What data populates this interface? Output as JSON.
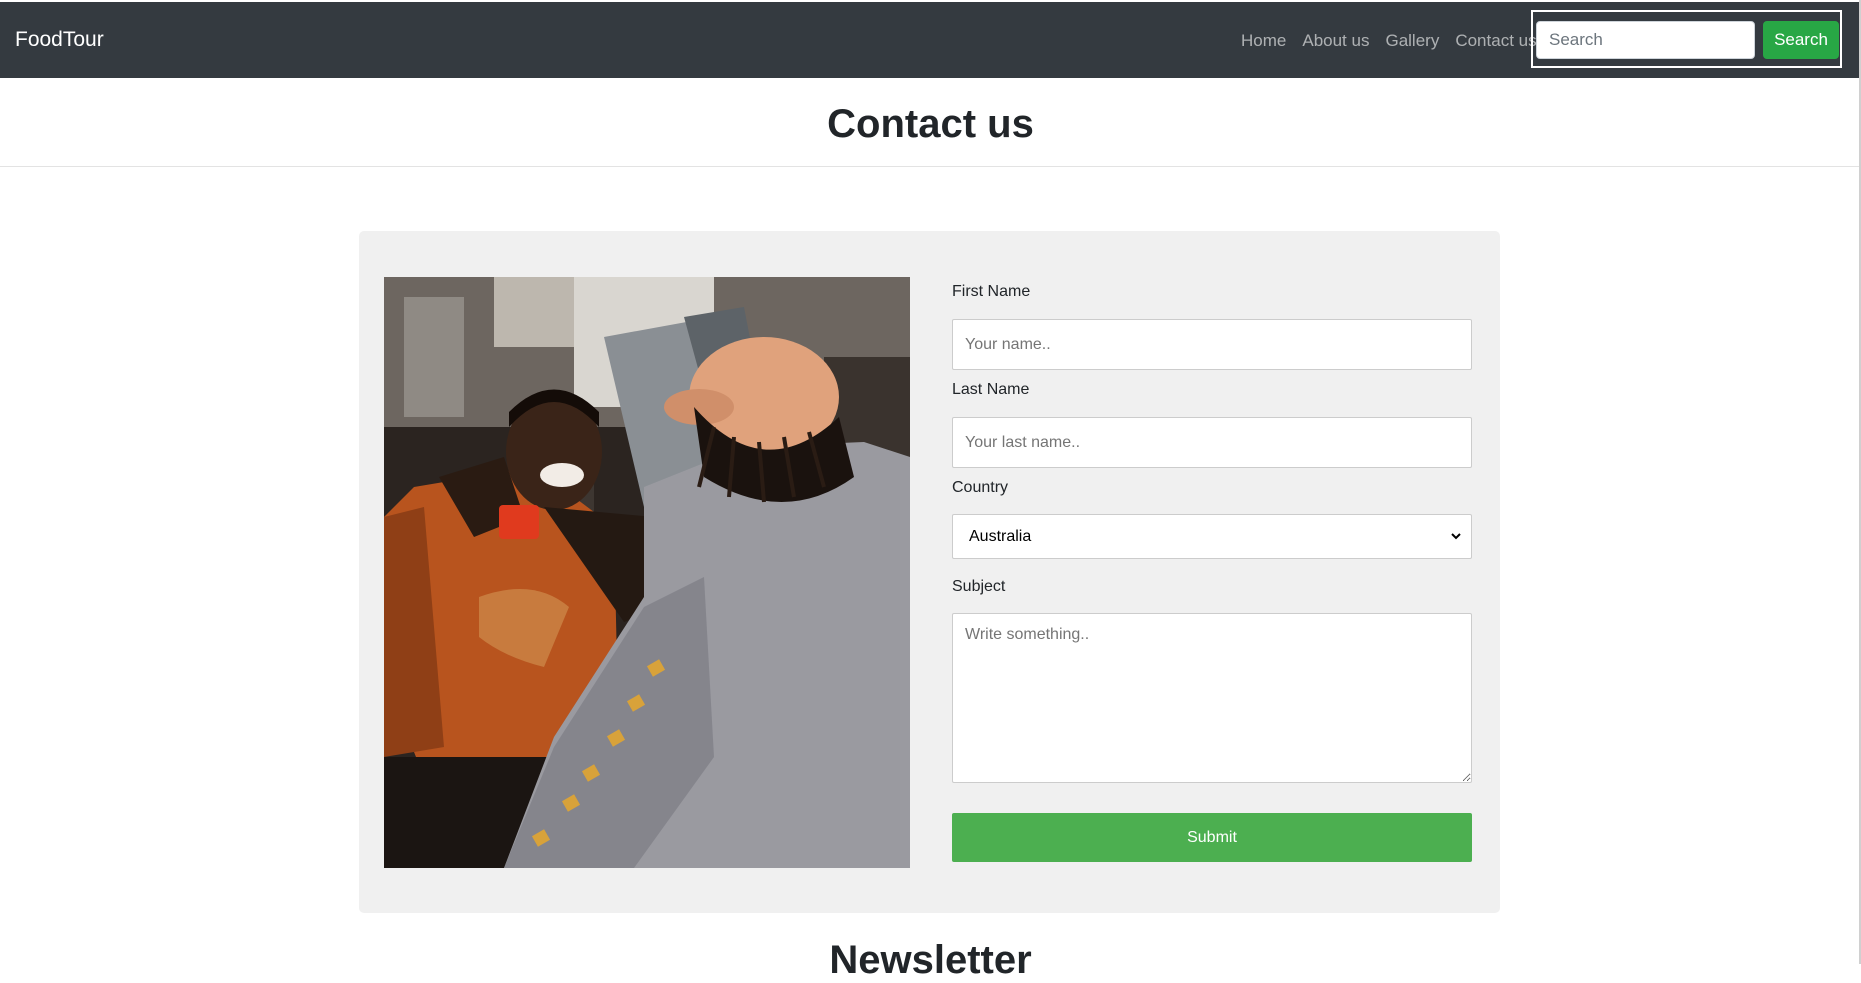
{
  "navbar": {
    "brand": "FoodTour",
    "links": [
      "Home",
      "About us",
      "Gallery",
      "Contact us"
    ],
    "search_placeholder": "Search",
    "search_button": "Search",
    "background_color": "#343a40",
    "button_color": "#28a745"
  },
  "page": {
    "title": "Contact us"
  },
  "form": {
    "first_name_label": "First Name",
    "first_name_placeholder": "Your name..",
    "last_name_label": "Last Name",
    "last_name_placeholder": "Your last name..",
    "country_label": "Country",
    "country_selected": "Australia",
    "subject_label": "Subject",
    "subject_placeholder": "Write something..",
    "submit_label": "Submit",
    "submit_color": "#4caf50"
  },
  "image": {
    "icon": "photo-people-in-kitchen"
  },
  "newsletter": {
    "title": "Newsletter"
  }
}
